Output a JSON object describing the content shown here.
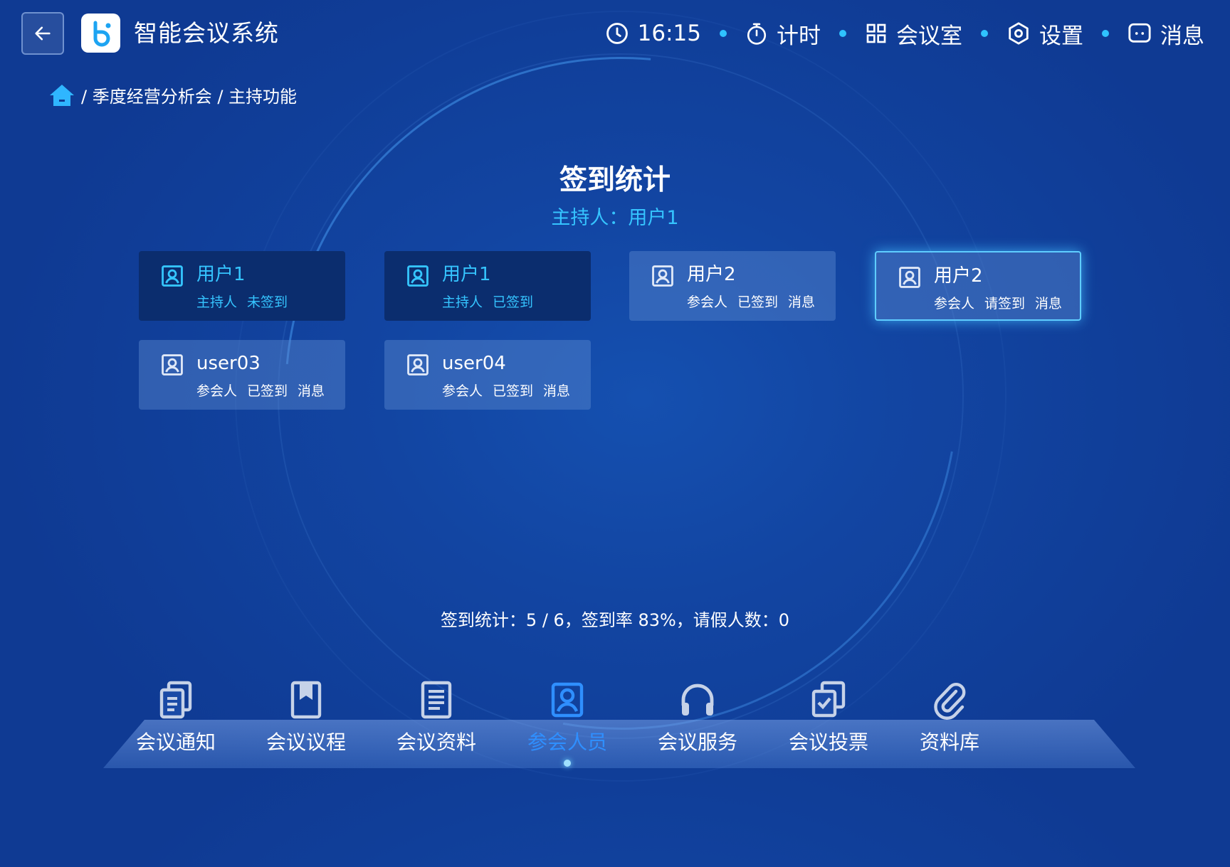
{
  "header": {
    "app_title": "智能会议系统",
    "time": "16:15",
    "nav": [
      {
        "label": "计时",
        "icon": "stopwatch-icon"
      },
      {
        "label": "会议室",
        "icon": "grid-icon"
      },
      {
        "label": "设置",
        "icon": "hexagon-settings-icon"
      },
      {
        "label": "消息",
        "icon": "message-icon"
      }
    ]
  },
  "breadcrumb": {
    "home_icon": "home-icon",
    "text": "/ 季度经营分析会 / 主持功能"
  },
  "page": {
    "title": "签到统计",
    "host_line": "主持人：用户1"
  },
  "attendees": [
    {
      "name": "用户1",
      "role": "主持人",
      "status": "未签到",
      "action": "",
      "style": "dark"
    },
    {
      "name": "用户1",
      "role": "主持人",
      "status": "已签到",
      "action": "",
      "style": "dark"
    },
    {
      "name": "用户2",
      "role": "参会人",
      "status": "已签到",
      "action": "消息",
      "style": "light"
    },
    {
      "name": "用户2",
      "role": "参会人",
      "status": "请签到",
      "action": "消息",
      "style": "glow"
    },
    {
      "name": "user03",
      "role": "参会人",
      "status": "已签到",
      "action": "消息",
      "style": "light"
    },
    {
      "name": "user04",
      "role": "参会人",
      "status": "已签到",
      "action": "消息",
      "style": "light"
    }
  ],
  "stats_text": "签到统计：5 / 6，签到率 83%，请假人数：0",
  "bottom_tabs": [
    {
      "label": "会议通知",
      "icon": "notice-docs-icon",
      "active": false
    },
    {
      "label": "会议议程",
      "icon": "bookmark-book-icon",
      "active": false
    },
    {
      "label": "会议资料",
      "icon": "document-icon",
      "active": false
    },
    {
      "label": "参会人员",
      "icon": "user-badge-icon",
      "active": true
    },
    {
      "label": "会议服务",
      "icon": "headset-icon",
      "active": false
    },
    {
      "label": "会议投票",
      "icon": "vote-check-icon",
      "active": false
    },
    {
      "label": "资料库",
      "icon": "paperclip-icon",
      "active": false
    }
  ],
  "colors": {
    "accent": "#35c4ff",
    "active_tab": "#2f8fff",
    "card_dark": "#0b2d6e"
  }
}
